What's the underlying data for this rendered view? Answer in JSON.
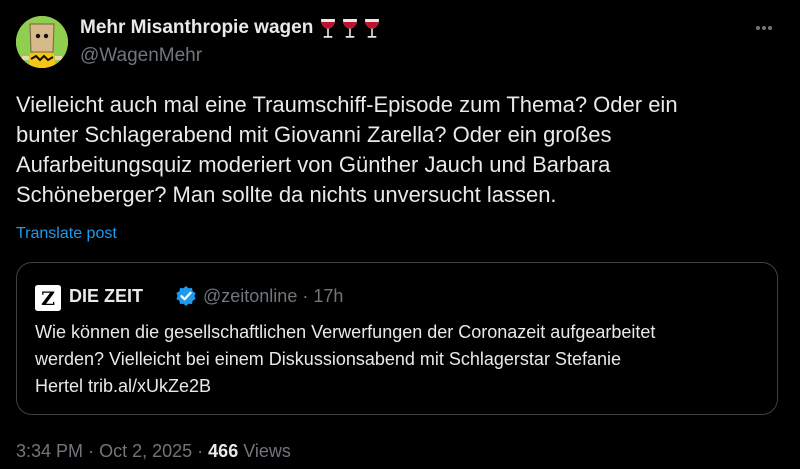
{
  "author": {
    "display_name": "Mehr Misanthropie wagen",
    "name_emojis": [
      "wine-glass",
      "wine-glass",
      "wine-glass"
    ],
    "handle": "@WagenMehr"
  },
  "tweet": {
    "text": "Vielleicht auch mal eine Traumschiff-Episode zum Thema? Oder ein\nbunter Schlagerabend mit Giovanni Zarella? Oder ein großes\nAufarbeitungsquiz moderiert von Günther Jauch und Barbara\nSchöneberger? Man sollte da nichts unversucht lassen.",
    "translate_label": "Translate post"
  },
  "quoted": {
    "name": "DIE ZEIT",
    "handle": "@zeitonline",
    "separator": "·",
    "time": "17h",
    "text": "Wie können die gesellschaftlichen Verwerfungen der Coronazeit aufgearbeitet\nwerden? Vielleicht bei einem Diskussionsabend mit Schlagerstar Stefanie\nHertel trib.al/xUkZe2B",
    "logo_letter": "Z"
  },
  "footer": {
    "time": "3:34 PM",
    "sep1": "·",
    "date": "Oct 2, 2025",
    "sep2": "·",
    "views_count": "466",
    "views_label": "Views"
  },
  "colors": {
    "background": "#000000",
    "text": "#e7e9ea",
    "muted": "#71767b",
    "link": "#1d9bf0",
    "border": "#3d4145",
    "verified": "#1d9bf0",
    "wine": "#c0122c"
  },
  "icons": {
    "more": "more-horizontal-icon",
    "verified": "verified-badge-icon",
    "name_emoji": "wine-glass-icon"
  }
}
